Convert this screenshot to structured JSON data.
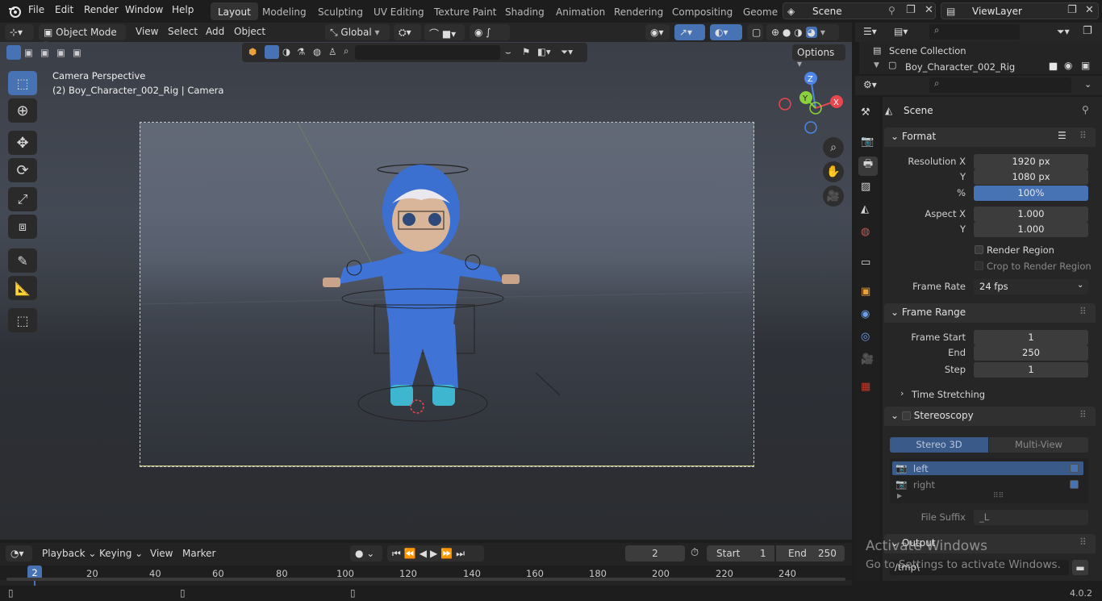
{
  "topbar": {
    "menu": [
      "File",
      "Edit",
      "Render",
      "Window",
      "Help"
    ],
    "workspaces": [
      "Layout",
      "Modeling",
      "Sculpting",
      "UV Editing",
      "Texture Paint",
      "Shading",
      "Animation",
      "Rendering",
      "Compositing",
      "Geomet"
    ],
    "active_workspace": "Layout",
    "scene_label": "Scene",
    "view_layer_label": "ViewLayer"
  },
  "viewport_header": {
    "mode": "Object Mode",
    "menus": [
      "View",
      "Select",
      "Add",
      "Object"
    ],
    "transform_orientation": "Global",
    "options_label": "Options"
  },
  "viewport": {
    "camera_title": "Camera Perspective",
    "object_info": "(2) Boy_Character_002_Rig | Camera",
    "gizmo_axes": {
      "z": "Z",
      "y": "Y",
      "x": "X"
    }
  },
  "outliner": {
    "root": "Scene Collection",
    "item": "Boy_Character_002_Rig"
  },
  "properties": {
    "context": "Scene",
    "format_panel": {
      "title": "Format",
      "resolution_x_label": "Resolution X",
      "resolution_x": "1920 px",
      "resolution_y_label": "Y",
      "resolution_y": "1080 px",
      "percent_label": "%",
      "percent": "100%",
      "aspect_x_label": "Aspect X",
      "aspect_x": "1.000",
      "aspect_y_label": "Y",
      "aspect_y": "1.000",
      "render_region": "Render Region",
      "crop_region": "Crop to Render Region",
      "frame_rate_label": "Frame Rate",
      "frame_rate": "24 fps"
    },
    "frame_range_panel": {
      "title": "Frame Range",
      "frame_start_label": "Frame Start",
      "frame_start": "1",
      "end_label": "End",
      "end": "250",
      "step_label": "Step",
      "step": "1",
      "time_stretching": "Time Stretching"
    },
    "stereoscopy_panel": {
      "title": "Stereoscopy",
      "tab_stereo": "Stereo 3D",
      "tab_multiview": "Multi-View",
      "views": [
        "left",
        "right"
      ],
      "file_suffix_label": "File Suffix",
      "file_suffix": "_L"
    },
    "output_panel": {
      "title": "Output",
      "path": "/tmp\\"
    }
  },
  "timeline": {
    "menus": [
      "Playback",
      "Keying",
      "View",
      "Marker"
    ],
    "current_frame": "2",
    "start_label": "Start",
    "start": "1",
    "end_label": "End",
    "end": "250",
    "ruler_current": "2",
    "ticks": [
      "20",
      "40",
      "60",
      "80",
      "100",
      "120",
      "140",
      "160",
      "180",
      "200",
      "220",
      "240"
    ]
  },
  "status": {
    "version": "4.0.2"
  },
  "watermark": {
    "line1": "Activate Windows",
    "line2": "Go to Settings to activate Windows."
  },
  "colors": {
    "accent": "#4772b3",
    "x_axis": "#e8474f",
    "y_axis": "#8bd13b",
    "z_axis": "#4d86e8"
  }
}
